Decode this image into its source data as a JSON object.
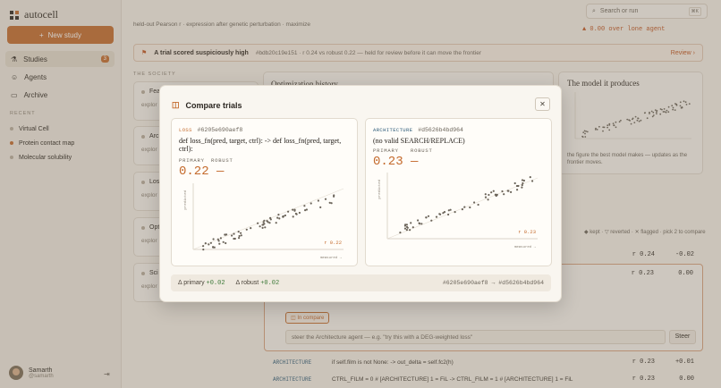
{
  "app": {
    "name": "autocell"
  },
  "sidebar": {
    "new_study": "New study",
    "nav": [
      {
        "label": "Studies",
        "badge": "3"
      },
      {
        "label": "Agents"
      },
      {
        "label": "Archive"
      }
    ],
    "recent_heading": "RECENT",
    "recent": [
      "Virtual Cell",
      "Protein contact map",
      "Molecular solubility"
    ],
    "user": {
      "name": "Samarth",
      "handle": "@samarth"
    }
  },
  "header": {
    "study_desc": "held-out Pearson r · expression after genetic perturbation · maximize",
    "search_placeholder": "Search or run",
    "search_kbd": "⌘K",
    "delta_over": "▲ 0.00 over lone agent"
  },
  "alert": {
    "title": "A trial scored suspiciously high",
    "detail": "#bdb20c19e151 · r 0.24 vs robust 0.22 — held for review before it can move the frontier",
    "action": "Review"
  },
  "society": {
    "heading": "THE SOCIETY",
    "agents": [
      {
        "name": "Fea",
        "sub": "explor"
      },
      {
        "name": "Arc",
        "sub": "explor"
      },
      {
        "name": "Los",
        "sub": "explor"
      },
      {
        "name": "Opt",
        "sub": "explor"
      },
      {
        "name": "Sci",
        "sub": "explor"
      }
    ]
  },
  "panels": {
    "optimization_title": "Optimization history",
    "model_title": "The model it produces",
    "model_caption": "the figure the best model makes — updates as the frontier moves.",
    "legend": "◆ kept · ▽ reverted · ✕ flagged · pick 2 to compare"
  },
  "trials": [
    {
      "agent": "",
      "desc": "",
      "v1": "r 0.24",
      "v2": "-0.02"
    },
    {
      "agent": "",
      "desc": "",
      "v1": "r 0.23",
      "v2": "0.00"
    },
    {
      "agent": "ARCHITECTURE",
      "desc": "if self.film is not None: -> out_delta = self.fc2(h)",
      "v1": "r 0.23",
      "v2": "+0.01"
    },
    {
      "agent": "ARCHITECTURE",
      "desc": "CTRL_FILM = 0 # [ARCHITECTURE] 1 = FiL -> CTRL_FILM = 1 # [ARCHITECTURE] 1 = FiL",
      "v1": "r 0.23",
      "v2": "0.00"
    }
  ],
  "expanded": {
    "in_compare": "In compare",
    "steer_placeholder": "steer the Architecture agent — e.g. \"try this with a DEG-weighted loss\"",
    "steer_button": "Steer"
  },
  "modal": {
    "title": "Compare trials",
    "left": {
      "tag": "LOSS",
      "hash": "#6205e690aef8",
      "code": "def loss_fn(pred, target, ctrl): -> def loss_fn(pred, target, ctrl):",
      "primary_label": "PRIMARY",
      "robust_label": "ROBUST",
      "primary": "0.22",
      "robust": "—",
      "plot_r": "r 0.22",
      "ylabel": "predicted",
      "xlabel": "measured →"
    },
    "right": {
      "tag": "ARCHITECTURE",
      "hash": "#d5626b4bd964",
      "code": "(no valid SEARCH/REPLACE)",
      "primary_label": "PRIMARY",
      "robust_label": "ROBUST",
      "primary": "0.23",
      "robust": "—",
      "plot_r": "r 0.23",
      "ylabel": "predicted",
      "xlabel": "measured →"
    },
    "summary": {
      "primary_label": "Δ primary",
      "primary_val": "+0.02",
      "robust_label": "Δ robust",
      "robust_val": "+0.02",
      "ids": "#6205e690aef8 → #d5626b4bd964"
    }
  },
  "colors": {
    "accent": "#c46a2c",
    "arch": "#2b5a78",
    "positive": "#3f7a3a"
  }
}
